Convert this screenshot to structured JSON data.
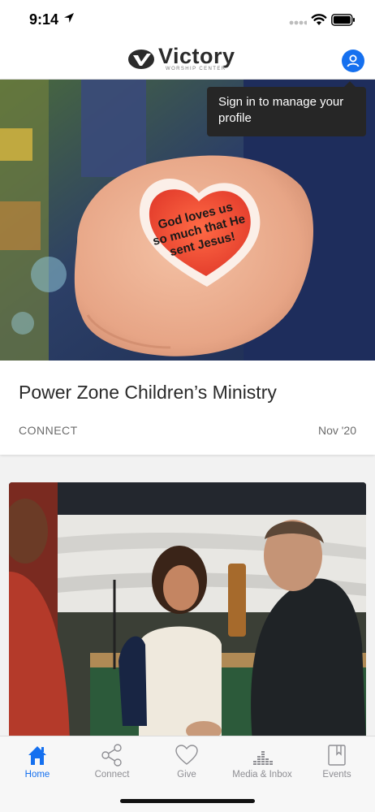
{
  "status_bar": {
    "time": "9:14"
  },
  "header": {
    "logo_text": "Victory",
    "logo_subtext": "WORSHIP CENTER",
    "profile_icon": "person-circle-icon",
    "accent_color": "#1570ef"
  },
  "tooltip": {
    "text": "Sign in to manage your profile"
  },
  "feed": {
    "items": [
      {
        "title": "Power Zone Children’s Ministry",
        "category": "CONNECT",
        "date": "Nov '20",
        "image": "child-hand-heart-sticker-photo",
        "sticker_text": [
          "God loves us",
          "so much that He",
          "sent Jesus!"
        ]
      },
      {
        "image": "people-greeting-in-church-photo"
      }
    ]
  },
  "tab_bar": {
    "tabs": [
      {
        "label": "Home",
        "icon": "home-icon",
        "active": true
      },
      {
        "label": "Connect",
        "icon": "share-icon",
        "active": false
      },
      {
        "label": "Give",
        "icon": "heart-icon",
        "active": false
      },
      {
        "label": "Media & Inbox",
        "icon": "equalizer-icon",
        "active": false
      },
      {
        "label": "Events",
        "icon": "bookmark-book-icon",
        "active": false
      }
    ]
  }
}
